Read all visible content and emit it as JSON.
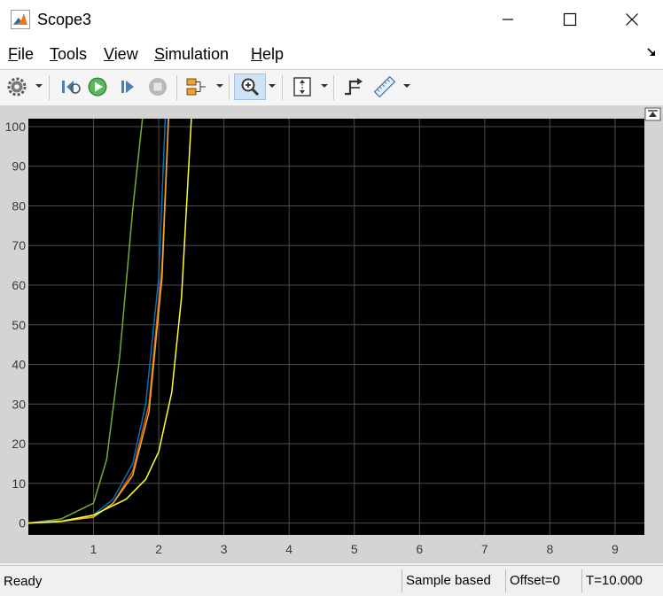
{
  "window": {
    "title": "Scope3"
  },
  "menu": [
    {
      "accel": "F",
      "rest": "ile"
    },
    {
      "accel": "T",
      "rest": "ools"
    },
    {
      "accel": "V",
      "rest": "iew"
    },
    {
      "accel": "S",
      "rest": "imulation"
    },
    {
      "accel": "H",
      "rest": "elp"
    }
  ],
  "toolbar": {
    "icons": [
      "gear-icon",
      "step-back-icon",
      "run-icon",
      "step-forward-icon",
      "stop-icon",
      "signal-selector-icon",
      "zoom-icon",
      "scale-axes-icon",
      "triggers-icon",
      "measurements-icon"
    ],
    "active": "zoom-icon"
  },
  "colors": {
    "plot_background": "#000000",
    "grid": "#4d4d4d",
    "tick_labels": "#3a3a3a",
    "series": [
      "#77ac30",
      "#0072bd",
      "#d95319",
      "#edb120",
      "#ffff33"
    ]
  },
  "chart_data": {
    "type": "line",
    "x_ticks": [
      "1",
      "2",
      "3",
      "4",
      "5",
      "6",
      "7",
      "8",
      "9"
    ],
    "y_ticks": [
      "0",
      "10",
      "20",
      "30",
      "40",
      "50",
      "60",
      "70",
      "80",
      "90",
      "100"
    ],
    "xlim": [
      0,
      9.45
    ],
    "ylim": [
      -3,
      102
    ],
    "grid": true,
    "series": [
      {
        "color": "#77ac30",
        "x": [
          0,
          0.5,
          1.0,
          1.2,
          1.4,
          1.6,
          1.75
        ],
        "y": [
          0,
          1,
          5,
          16,
          42,
          79,
          102
        ]
      },
      {
        "color": "#0072bd",
        "x": [
          0,
          0.5,
          1.0,
          1.3,
          1.6,
          1.8,
          2.0,
          2.1
        ],
        "y": [
          0,
          0.5,
          2,
          6,
          15,
          30,
          62,
          102
        ]
      },
      {
        "color": "#d95319",
        "x": [
          0,
          0.5,
          1.0,
          1.3,
          1.6,
          1.85,
          2.05,
          2.15
        ],
        "y": [
          0,
          0.4,
          1.5,
          5,
          13,
          30,
          65,
          102
        ]
      },
      {
        "color": "#edb120",
        "x": [
          0,
          0.5,
          1.0,
          1.3,
          1.6,
          1.85,
          2.05,
          2.15
        ],
        "y": [
          0,
          0.4,
          1.5,
          5,
          12,
          28,
          62,
          102
        ]
      },
      {
        "color": "#ffff33",
        "x": [
          0,
          0.5,
          1.0,
          1.5,
          1.8,
          2.0,
          2.2,
          2.35,
          2.5
        ],
        "y": [
          0,
          0.4,
          2,
          6,
          11,
          18,
          33,
          57,
          102
        ]
      }
    ]
  },
  "status": {
    "state": "Ready",
    "sample_mode": "Sample based",
    "offset": "Offset=0",
    "time": "T=10.000"
  }
}
